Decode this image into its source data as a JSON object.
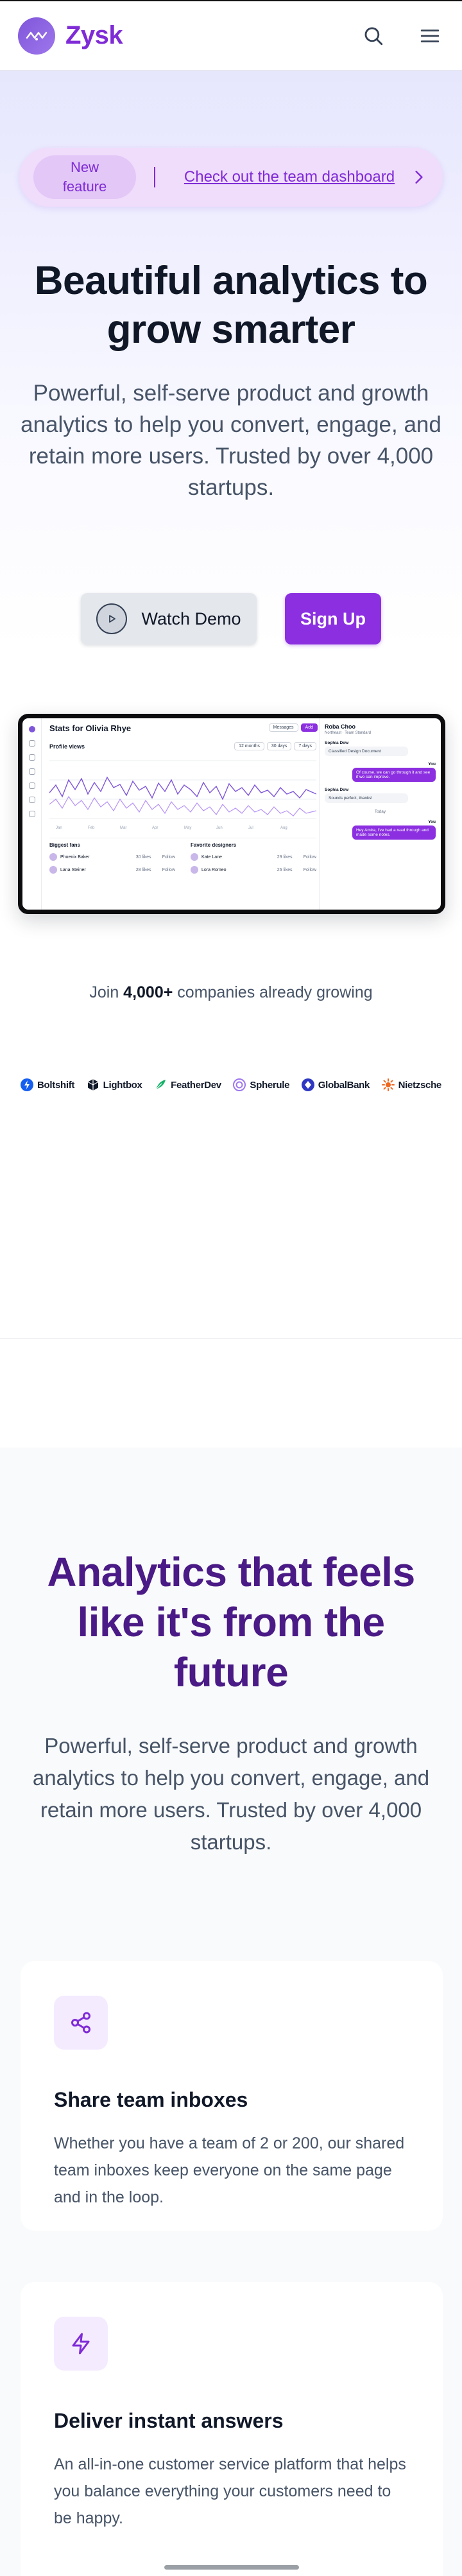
{
  "header": {
    "brand_name": "Zysk",
    "icons": [
      "logo-mark",
      "search-icon",
      "menu-icon"
    ]
  },
  "announcement": {
    "badge": "New feature",
    "link_text": "Check out the team dashboard",
    "icon": "chevron-right-icon"
  },
  "hero": {
    "title": "Beautiful analytics to grow smarter",
    "subtitle": "Powerful, self-serve product and growth analytics to help you convert, engage, and retain more users. Trusted by over 4,000 startups.",
    "demo_label": "Watch Demo",
    "signup_label": "Sign Up"
  },
  "mockup": {
    "title": "Stats for Olivia Rhye",
    "btn_messages": "Messages",
    "btn_add": "Add",
    "section": "Profile views",
    "ranges": [
      "12 months",
      "30 days",
      "7 days"
    ],
    "list1_title": "Biggest fans",
    "list2_title": "Favorite designers",
    "list1": [
      {
        "name": "Phoenix Baker",
        "meta": "30 likes",
        "act": "Follow"
      },
      {
        "name": "Lana Steiner",
        "meta": "28 likes",
        "act": "Follow"
      }
    ],
    "list2": [
      {
        "name": "Kate Lane",
        "meta": "29 likes",
        "act": "Follow"
      },
      {
        "name": "Lora Romeo",
        "meta": "26 likes",
        "act": "Follow"
      }
    ],
    "chat": {
      "name": "Roba Choo",
      "status": "Northeast · Team Standard",
      "m1_who": "Sophia Dow",
      "m1_text": "Classified Design Document",
      "m2_who": "You",
      "m2_text": "Of course, we can go through it and see if we can improve.",
      "m3_who": "Sophia Dow",
      "m3_text": "Sounds perfect, thanks!",
      "today": "Today",
      "m4_who": "You",
      "m4_text": "Hey Amira, I've had a read through and made some notes."
    }
  },
  "social": {
    "join_prefix": "Join ",
    "join_count": "4,000+",
    "join_suffix": " companies already growing",
    "logos": [
      "Boltshift",
      "Lightbox",
      "FeatherDev",
      "Spherule",
      "GlobalBank",
      "Nietzsche"
    ]
  },
  "features": {
    "title": "Analytics that feels like it's from the future",
    "subtitle": "Powerful, self-serve product and growth analytics to help you convert, engage, and retain more users. Trusted by over 4,000 startups.",
    "items": [
      {
        "icon": "share-icon",
        "title": "Share team inboxes",
        "body": "Whether you have a team of 2 or 200, our shared team inboxes keep everyone on the same page and in the loop."
      },
      {
        "icon": "lightning-icon",
        "title": "Deliver instant answers",
        "body": "An all-in-one customer service platform that helps you balance everything your customers need to be happy."
      }
    ]
  },
  "colors": {
    "brand": "#7f2bd6",
    "button_primary": "#8b2fe0",
    "feature_title": "#4a1a86"
  }
}
